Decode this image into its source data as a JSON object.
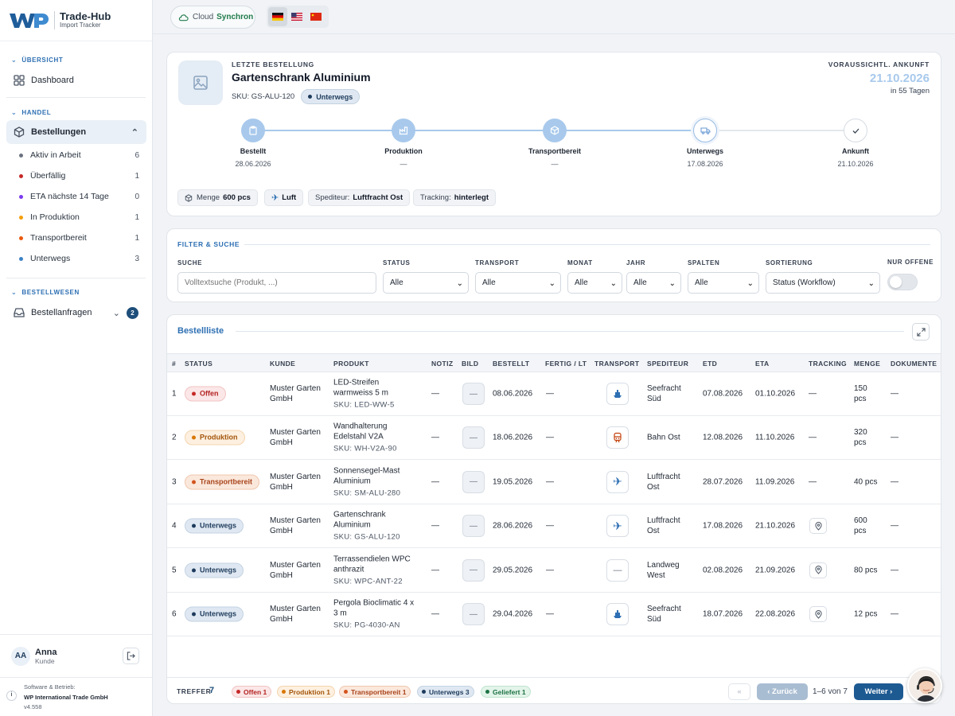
{
  "brand": {
    "name": "Trade-Hub",
    "sub": "Import Tracker"
  },
  "sidebar": {
    "sections": [
      {
        "title": "ÜBERSICHT"
      },
      {
        "title": "HANDEL"
      },
      {
        "title": "BESTELLWESEN"
      }
    ],
    "dashboard": "Dashboard",
    "bestellungen": "Bestellungen",
    "sub_items": [
      {
        "label": "Aktiv in Arbeit",
        "count": "6",
        "color": "#6b7280"
      },
      {
        "label": "Überfällig",
        "count": "1",
        "color": "#c62828"
      },
      {
        "label": "ETA nächste 14 Tage",
        "count": "0",
        "color": "#7c3aed"
      },
      {
        "label": "In Produktion",
        "count": "1",
        "color": "#f59e0b"
      },
      {
        "label": "Transportbereit",
        "count": "1",
        "color": "#ea580c"
      },
      {
        "label": "Unterwegs",
        "count": "3",
        "color": "#3b82c4"
      }
    ],
    "anfragen": "Bestellanfragen",
    "anfragen_count": "2",
    "user": {
      "initials": "AA",
      "name": "Anna",
      "role": "Kunde"
    },
    "footer": {
      "line1": "Software & Betrieb:",
      "line2": "WP International Trade GmbH",
      "version": "v4.558"
    }
  },
  "topbar": {
    "cloud_label": "Cloud",
    "cloud_status": "Synchron"
  },
  "order": {
    "eyebrow": "LETZTE BESTELLUNG",
    "title": "Gartenschrank Aluminium",
    "sku": "SKU: GS-ALU-120",
    "status": "Unterwegs",
    "eta_label": "VORAUSSICHTL. ANKUNFT",
    "eta_date": "21.10.2026",
    "eta_rel": "in 55 Tagen",
    "steps": [
      {
        "label": "Bestellt",
        "date": "28.06.2026"
      },
      {
        "label": "Produktion",
        "date": "—"
      },
      {
        "label": "Transportbereit",
        "date": "—"
      },
      {
        "label": "Unterwegs",
        "date": "17.08.2026"
      },
      {
        "label": "Ankunft",
        "date": "21.10.2026"
      }
    ],
    "chips": {
      "menge_label": "Menge",
      "menge": "600 pcs",
      "transport": "Luft",
      "spediteur_label": "Spediteur:",
      "spediteur": "Luftfracht Ost",
      "tracking_label": "Tracking:",
      "tracking": "hinterlegt"
    }
  },
  "filter": {
    "title": "FILTER & SUCHE",
    "suche_label": "SUCHE",
    "suche_placeholder": "Volltextsuche (Produkt, ...)",
    "status_label": "STATUS",
    "status_value": "Alle",
    "transport_label": "TRANSPORT",
    "transport_value": "Alle",
    "monat_label": "MONAT",
    "monat_value": "Alle",
    "jahr_label": "JAHR",
    "jahr_value": "Alle",
    "spalten_label": "SPALTEN",
    "spalten_value": "Alle",
    "sortierung_label": "SORTIERUNG",
    "sortierung_value": "Status (Workflow)",
    "offene_label": "NUR OFFENE"
  },
  "list": {
    "title": "Bestellliste",
    "columns": [
      "#",
      "STATUS",
      "KUNDE",
      "PRODUKT",
      "NOTIZ",
      "BILD",
      "BESTELLT",
      "FERTIG / LT",
      "TRANSPORT",
      "SPEDITEUR",
      "ETD",
      "ETA",
      "TRACKING",
      "MENGE",
      "DOKUMENTE"
    ],
    "rows": [
      {
        "n": "1",
        "status": "Offen",
        "cls": "p-offen",
        "kunde1": "Muster Garten",
        "kunde2": "GmbH",
        "prod1": "LED-Streifen",
        "prod2": "warmweiss 5 m",
        "sku": "SKU: LED-WW-5",
        "notiz": "—",
        "bild": "—",
        "bestellt": "08.06.2026",
        "fertig": "—",
        "transport": "ship-icon",
        "sped1": "Seefracht",
        "sped2": "Süd",
        "etd": "07.08.2026",
        "eta": "01.10.2026",
        "tracking": "—",
        "menge1": "150",
        "menge2": "pcs",
        "doks": "—"
      },
      {
        "n": "2",
        "status": "Produktion",
        "cls": "p-produktion",
        "kunde1": "Muster Garten",
        "kunde2": "GmbH",
        "prod1": "Wandhalterung",
        "prod2": "Edelstahl V2A",
        "sku": "SKU: WH-V2A-90",
        "notiz": "—",
        "bild": "—",
        "bestellt": "18.06.2026",
        "fertig": "—",
        "transport": "train-icon",
        "sped1": "Bahn Ost",
        "sped2": "",
        "etd": "12.08.2026",
        "eta": "11.10.2026",
        "tracking": "—",
        "menge1": "320",
        "menge2": "pcs",
        "doks": "—"
      },
      {
        "n": "3",
        "status": "Transportbereit",
        "cls": "p-transport",
        "kunde1": "Muster Garten",
        "kunde2": "GmbH",
        "prod1": "Sonnensegel-Mast",
        "prod2": "Aluminium",
        "sku": "SKU: SM-ALU-280",
        "notiz": "—",
        "bild": "—",
        "bestellt": "19.05.2026",
        "fertig": "—",
        "transport": "plane-icon",
        "sped1": "Luftfracht",
        "sped2": "Ost",
        "etd": "28.07.2026",
        "eta": "11.09.2026",
        "tracking": "—",
        "menge1": "40 pcs",
        "menge2": "",
        "doks": "—"
      },
      {
        "n": "4",
        "status": "Unterwegs",
        "cls": "p-unterwegs",
        "kunde1": "Muster Garten",
        "kunde2": "GmbH",
        "prod1": "Gartenschrank",
        "prod2": "Aluminium",
        "sku": "SKU: GS-ALU-120",
        "notiz": "—",
        "bild": "—",
        "bestellt": "28.06.2026",
        "fertig": "—",
        "transport": "plane-icon",
        "sped1": "Luftfracht",
        "sped2": "Ost",
        "etd": "17.08.2026",
        "eta": "21.10.2026",
        "tracking": "pin",
        "menge1": "600",
        "menge2": "pcs",
        "doks": "—"
      },
      {
        "n": "5",
        "status": "Unterwegs",
        "cls": "p-unterwegs",
        "kunde1": "Muster Garten",
        "kunde2": "GmbH",
        "prod1": "Terrassendielen WPC",
        "prod2": "anthrazit",
        "sku": "SKU: WPC-ANT-22",
        "notiz": "—",
        "bild": "—",
        "bestellt": "29.05.2026",
        "fertig": "—",
        "transport": "dash",
        "sped1": "Landweg",
        "sped2": "West",
        "etd": "02.08.2026",
        "eta": "21.09.2026",
        "tracking": "pin",
        "menge1": "80 pcs",
        "menge2": "",
        "doks": "—"
      },
      {
        "n": "6",
        "status": "Unterwegs",
        "cls": "p-unterwegs",
        "kunde1": "Muster Garten",
        "kunde2": "GmbH",
        "prod1": "Pergola Bioclimatic 4 x",
        "prod2": "3 m",
        "sku": "SKU: PG-4030-AN",
        "notiz": "—",
        "bild": "—",
        "bestellt": "29.04.2026",
        "fertig": "—",
        "transport": "ship-icon",
        "sped1": "Seefracht",
        "sped2": "Süd",
        "etd": "18.07.2026",
        "eta": "22.08.2026",
        "tracking": "pin",
        "menge1": "12 pcs",
        "menge2": "",
        "doks": "—"
      }
    ],
    "footer": {
      "treffer_label": "TREFFER",
      "treffer": "7",
      "pills": [
        "Offen 1",
        "Produktion 1",
        "Transportbereit 1",
        "Unterwegs 3",
        "Geliefert 1"
      ],
      "first": "«",
      "prev": "‹ Zurück",
      "range": "1–6 von 7",
      "next": "Weiter ›"
    }
  },
  "colors": {
    "accent": "#2d6fb3",
    "navy": "#1e4e7a",
    "eta": "#a8c9ec"
  }
}
